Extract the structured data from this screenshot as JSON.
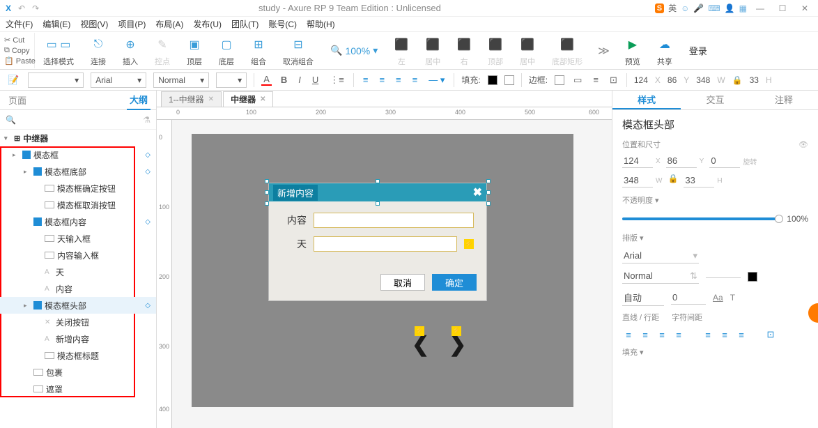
{
  "title": "study - Axure RP 9 Team Edition : Unlicensed",
  "ime": {
    "badge": "S",
    "lang": "英"
  },
  "menubar": [
    "文件(F)",
    "编辑(E)",
    "视图(V)",
    "项目(P)",
    "布局(A)",
    "发布(U)",
    "团队(T)",
    "账号(C)",
    "帮助(H)"
  ],
  "clip": {
    "cut": "Cut",
    "copy": "Copy",
    "paste": "Paste"
  },
  "ribbon": {
    "select": "选择模式",
    "connect": "连接",
    "insert": "插入",
    "control": "控点",
    "front": "顶层",
    "back": "底层",
    "group": "组合",
    "ungroup": "取消组合",
    "zoom": "100%",
    "left": "左",
    "center": "居中",
    "right": "右",
    "top": "顶部",
    "middle": "居中",
    "bottom": "底部矩形",
    "preview": "预览",
    "share": "共享",
    "login": "登录"
  },
  "fmt": {
    "font": "Arial",
    "weight": "Normal",
    "size": "",
    "fillLabel": "填充:",
    "borderLabel": "边框:",
    "x": "124",
    "xl": "X",
    "y": "86",
    "yl": "Y",
    "w": "348",
    "wl": "W",
    "h": "33",
    "hl": "H"
  },
  "leftpanel": {
    "tabPage": "页面",
    "tabOutline": "大纲",
    "root": "中继器",
    "items": [
      {
        "label": "模态框",
        "type": "folder",
        "lvl": 1,
        "diam": true,
        "tw": "▸"
      },
      {
        "label": "模态框底部",
        "type": "folder",
        "lvl": 2,
        "diam": true,
        "tw": "▸"
      },
      {
        "label": "模态框确定按钮",
        "type": "rect",
        "lvl": 3
      },
      {
        "label": "模态框取消按钮",
        "type": "rect",
        "lvl": 3
      },
      {
        "label": "模态框内容",
        "type": "folder",
        "lvl": 2,
        "diam": true
      },
      {
        "label": "天输入框",
        "type": "rect",
        "lvl": 3
      },
      {
        "label": "内容输入框",
        "type": "rect",
        "lvl": 3
      },
      {
        "label": "天",
        "type": "text",
        "lvl": 3
      },
      {
        "label": "内容",
        "type": "text",
        "lvl": 3
      },
      {
        "label": "模态框头部",
        "type": "folder",
        "lvl": 2,
        "diam": true,
        "sel": true,
        "tw": "▸"
      },
      {
        "label": "关闭按钮",
        "type": "x",
        "lvl": 3
      },
      {
        "label": "新增内容",
        "type": "text",
        "lvl": 3
      },
      {
        "label": "模态框标题",
        "type": "rect",
        "lvl": 3
      },
      {
        "label": "包裹",
        "type": "rect",
        "lvl": 2
      },
      {
        "label": "遮罩",
        "type": "rect",
        "lvl": 2
      }
    ]
  },
  "tabs": [
    {
      "label": "1--中继器",
      "active": false
    },
    {
      "label": "中继器",
      "active": true
    }
  ],
  "rulerH": [
    "0",
    "100",
    "200",
    "300",
    "400",
    "500",
    "600"
  ],
  "rulerV": [
    "0",
    "100",
    "200",
    "300",
    "400"
  ],
  "modal": {
    "title": "新增内容",
    "lblContent": "内容",
    "lblDay": "天",
    "cancel": "取消",
    "ok": "确定"
  },
  "right": {
    "tabs": [
      "样式",
      "交互",
      "注释"
    ],
    "title": "模态框头部",
    "secPos": "位置和尺寸",
    "x": "124",
    "y": "86",
    "rot": "0",
    "rotL": "旋转",
    "w": "348",
    "h": "33",
    "secOpacity": "不透明度 ▾",
    "opacity": "100%",
    "secType": "排版 ▾",
    "font": "Arial",
    "weight": "Normal",
    "auto": "自动",
    "zero": "0",
    "lineH": "直线 / 行距",
    "letter": "字符间距",
    "secFill": "填充 ▾"
  }
}
